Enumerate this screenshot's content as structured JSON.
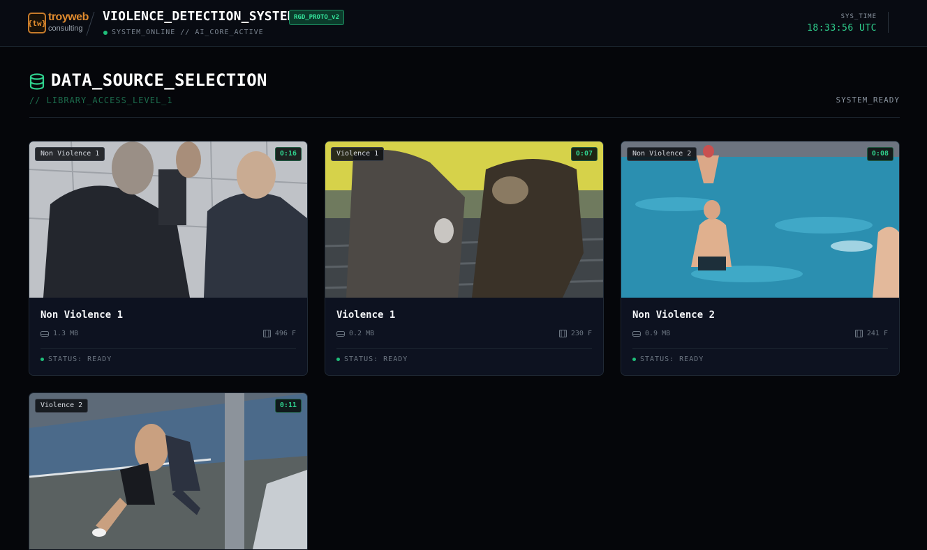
{
  "header": {
    "logo_primary": "troyweb",
    "logo_secondary": "consulting",
    "logo_mark": "{tw}",
    "title": "VIOLENCE_DETECTION_SYSTEM",
    "badge": "RGD_PROTO_v2",
    "status": "SYSTEM_ONLINE // AI_CORE_ACTIVE",
    "time_label": "SYS_TIME",
    "time_value": "18:33:56 UTC"
  },
  "section": {
    "title": "DATA_SOURCE_SELECTION",
    "subtitle": "// LIBRARY_ACCESS_LEVEL_1",
    "state": "SYSTEM_READY",
    "icon": "database-icon"
  },
  "videos": [
    {
      "tag": "Non Violence 1",
      "duration": "0:16",
      "title": "Non Violence 1",
      "size": "1.3 MB",
      "frames": "496 F",
      "status": "STATUS: READY"
    },
    {
      "tag": "Violence 1",
      "duration": "0:07",
      "title": "Violence 1",
      "size": "0.2 MB",
      "frames": "230 F",
      "status": "STATUS: READY"
    },
    {
      "tag": "Non Violence 2",
      "duration": "0:08",
      "title": "Non Violence 2",
      "size": "0.9 MB",
      "frames": "241 F",
      "status": "STATUS: READY"
    },
    {
      "tag": "Violence 2",
      "duration": "0:11"
    }
  ],
  "colors": {
    "accent": "#2fd18e",
    "background": "#05060a",
    "card": "#0d1220",
    "brand": "#e08b2e"
  }
}
